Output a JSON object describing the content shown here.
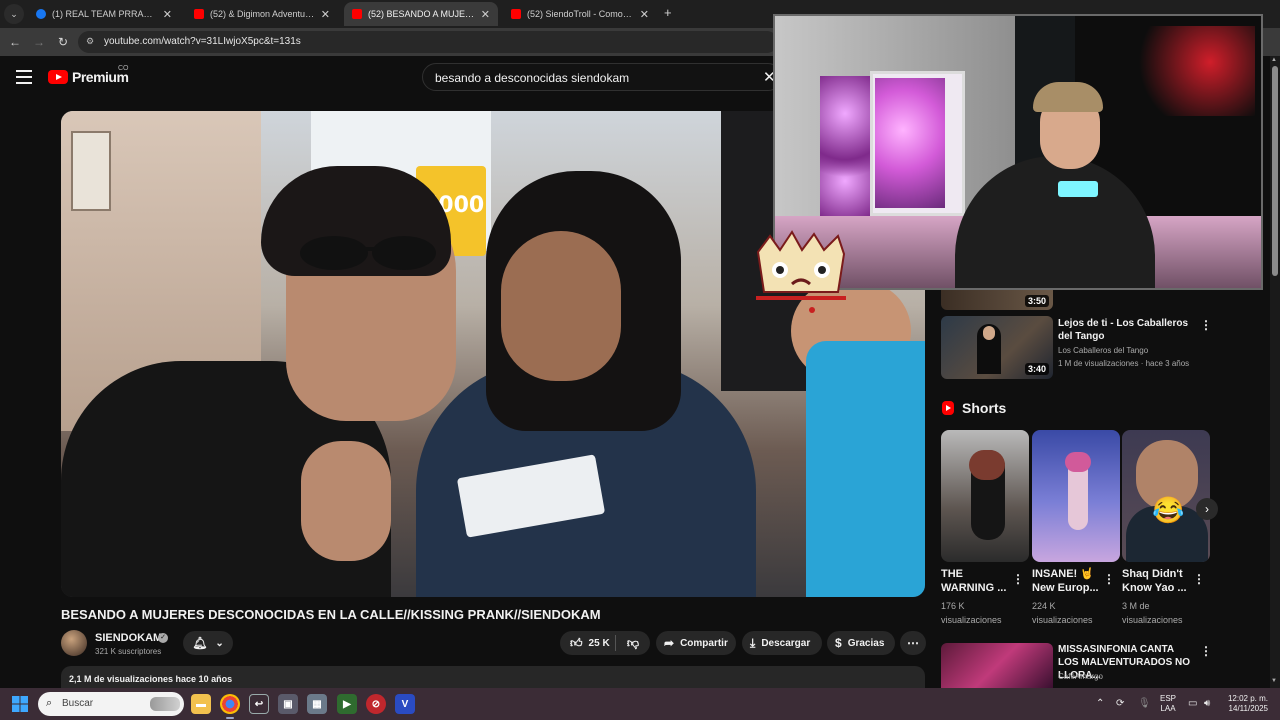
{
  "browser": {
    "tabs": [
      {
        "label": "(1) REAL TEAM PRRAS! | Facebo",
        "favicon": "facebook-icon",
        "color": "#1877f2",
        "active": false
      },
      {
        "label": "(52) & Digimon Adventure — B",
        "favicon": "youtube-icon",
        "color": "#ff0000",
        "active": false
      },
      {
        "label": "(52) BESANDO A MUJERES DES",
        "favicon": "youtube-icon",
        "color": "#ff0000",
        "active": true
      },
      {
        "label": "(52) SiendoTroll - Como salir co",
        "favicon": "youtube-icon",
        "color": "#ff0000",
        "active": false
      }
    ],
    "url": "youtube.com/watch?v=31LIwjoX5pc&t=131s"
  },
  "header": {
    "brand": "Premium",
    "country": "CO",
    "search_query": "besando a desconocidas siendokam"
  },
  "video": {
    "sign_text": "5000",
    "title": "BESANDO A MUJERES DESCONOCIDAS EN LA CALLE//KISSING PRANK//SIENDOKAM",
    "channel": "SIENDOKAM",
    "subscribers": "321 K suscriptores",
    "likes": "25 K",
    "share_label": "Compartir",
    "download_label": "Descargar",
    "thanks_label": "Gracias",
    "views_line": "2,1 M de visualizaciones  hace 10 años"
  },
  "sidebar": {
    "partial_duration": "3:50",
    "item": {
      "title": "Lejos de ti - Los Caballeros del Tango",
      "channel": "Los Caballeros del Tango",
      "meta": "1 M de visualizaciones · hace 3 años",
      "duration": "3:40"
    },
    "shorts_title": "Shorts",
    "shorts": [
      {
        "title": "THE WARNING ...",
        "views": "176 K visualizaciones"
      },
      {
        "title": "INSANE! 🤘 New Europ...",
        "views": "224 K visualizaciones"
      },
      {
        "title": "Shaq Didn't Know Yao ...",
        "views": "3 M de visualizaciones"
      }
    ],
    "next_item": {
      "title": "MISSASINFONIA CANTA LOS MALVENTURADOS NO LLORA...",
      "channel": "CaféAmargo"
    }
  },
  "taskbar": {
    "search_placeholder": "Buscar",
    "lang_top": "ESP",
    "lang_bottom": "LAA",
    "time": "12:02 p. m.",
    "date": "14/11/2025"
  }
}
